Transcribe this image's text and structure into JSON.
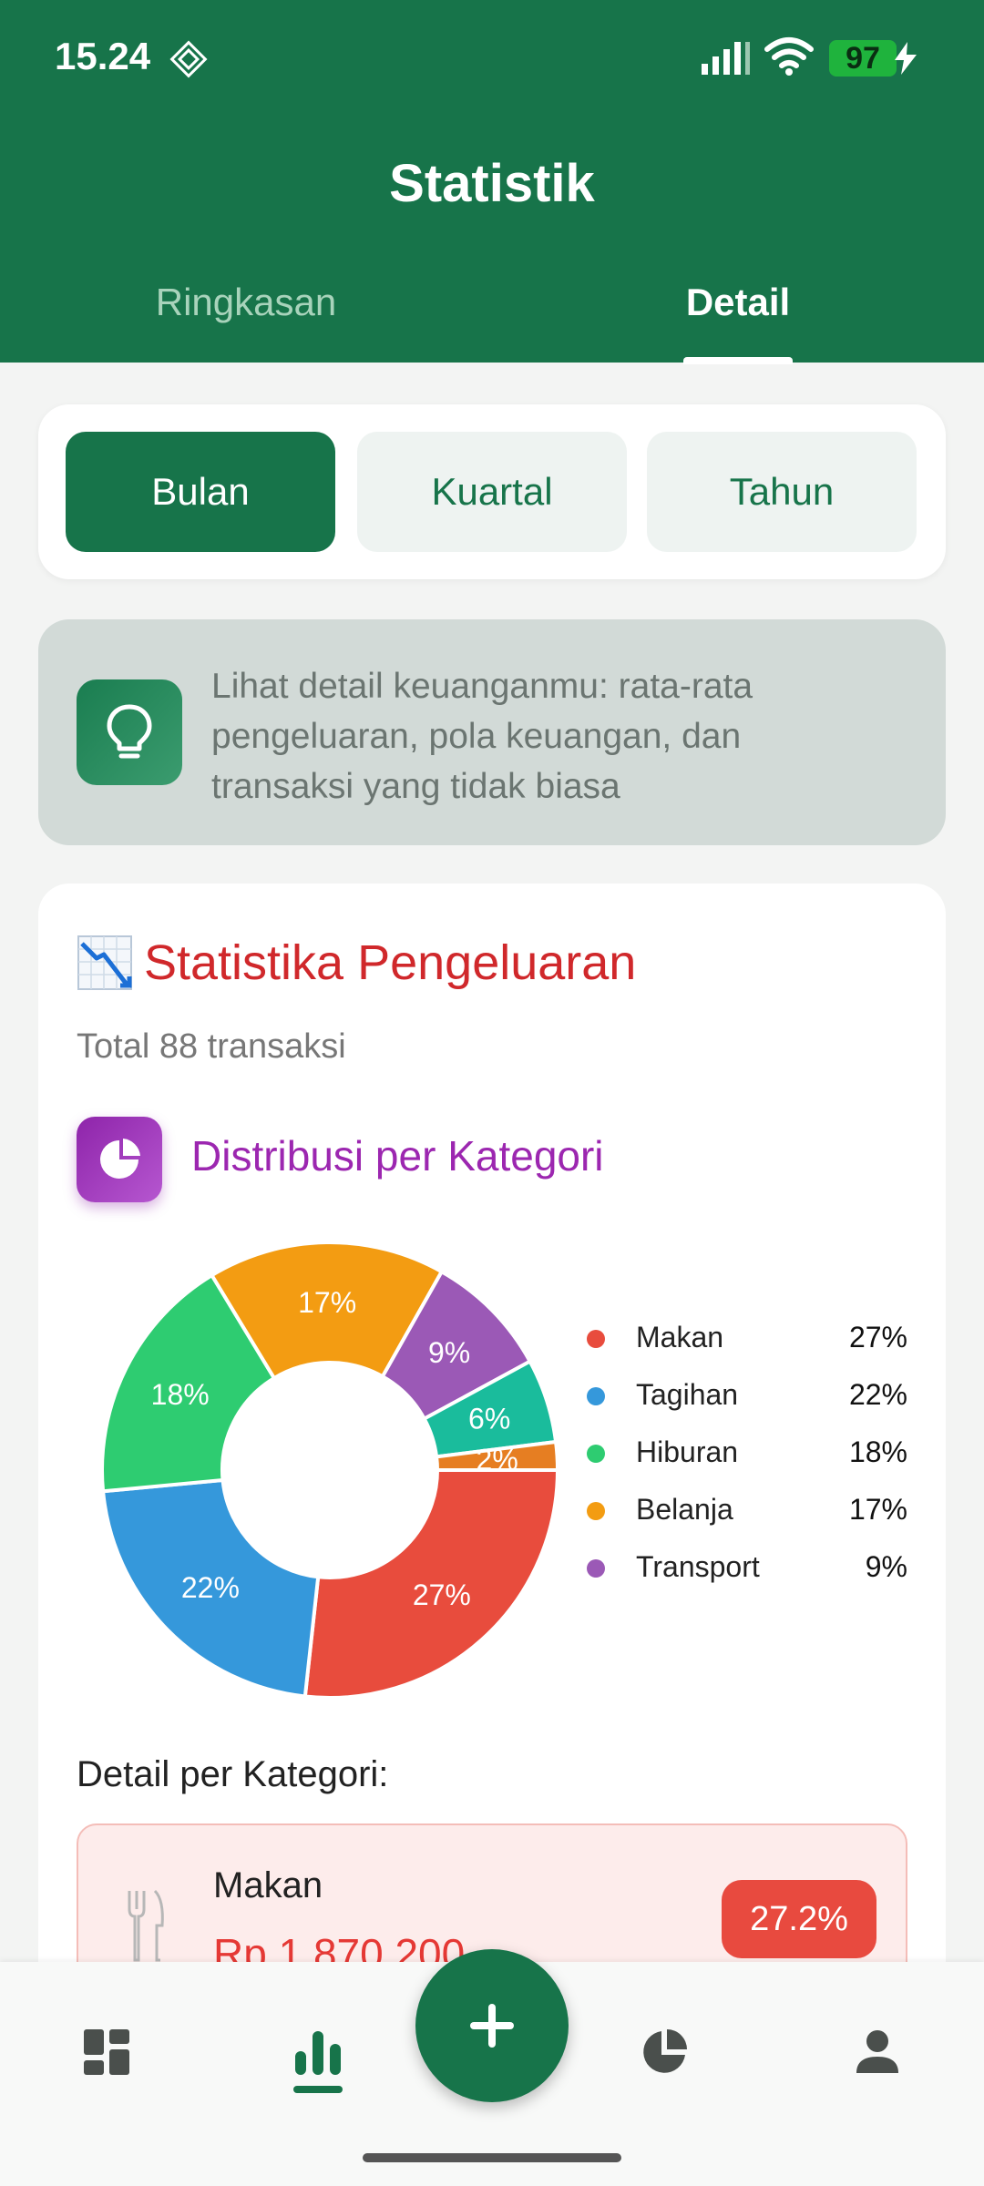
{
  "status_bar": {
    "time": "15.24",
    "battery": "97"
  },
  "header": {
    "title": "Statistik",
    "tabs": [
      {
        "label": "Ringkasan",
        "active": false
      },
      {
        "label": "Detail",
        "active": true
      }
    ]
  },
  "period": {
    "options": [
      "Bulan",
      "Kuartal",
      "Tahun"
    ],
    "selected": "Bulan"
  },
  "info": {
    "text": "Lihat detail keuanganmu: rata-rata pengeluaran, pola keuangan, dan transaksi yang tidak biasa"
  },
  "stats": {
    "title": "Statistika Pengeluaran",
    "subtitle": "Total 88 transaksi",
    "distribution_title": "Distribusi per Kategori",
    "detail_heading": "Detail per Kategori:",
    "category_card": {
      "name": "Makan",
      "amount": "Rp 1.870.200",
      "percent": "27.2%"
    }
  },
  "colors": {
    "brand": "#17744a",
    "Makan": "#e84c3d",
    "Tagihan": "#3598db",
    "Hiburan": "#2ecc71",
    "Belanja": "#f39c12",
    "Transport": "#9b59b6",
    "Other1": "#1abc9c",
    "Other2": "#e67e22"
  },
  "chart_data": {
    "type": "pie",
    "title": "Distribusi per Kategori",
    "slices": [
      {
        "label": "Makan",
        "value": 27,
        "color": "#e84c3d"
      },
      {
        "label": "Tagihan",
        "value": 22,
        "color": "#3598db"
      },
      {
        "label": "Hiburan",
        "value": 18,
        "color": "#2ecc71"
      },
      {
        "label": "Belanja",
        "value": 17,
        "color": "#f39c12"
      },
      {
        "label": "Transport",
        "value": 9,
        "color": "#9b59b6"
      },
      {
        "label": "",
        "value": 6,
        "color": "#1abc9c"
      },
      {
        "label": "",
        "value": 2,
        "color": "#e67e22"
      }
    ],
    "legend": [
      {
        "name": "Makan",
        "percent": "27%",
        "color": "#e84c3d"
      },
      {
        "name": "Tagihan",
        "percent": "22%",
        "color": "#3598db"
      },
      {
        "name": "Hiburan",
        "percent": "18%",
        "color": "#2ecc71"
      },
      {
        "name": "Belanja",
        "percent": "17%",
        "color": "#f39c12"
      },
      {
        "name": "Transport",
        "percent": "9%",
        "color": "#9b59b6"
      }
    ]
  },
  "bottom_nav": {
    "items": [
      "dashboard-icon",
      "stats-icon",
      "add-icon",
      "pie-chart-icon",
      "profile-icon"
    ],
    "active": "stats-icon"
  }
}
